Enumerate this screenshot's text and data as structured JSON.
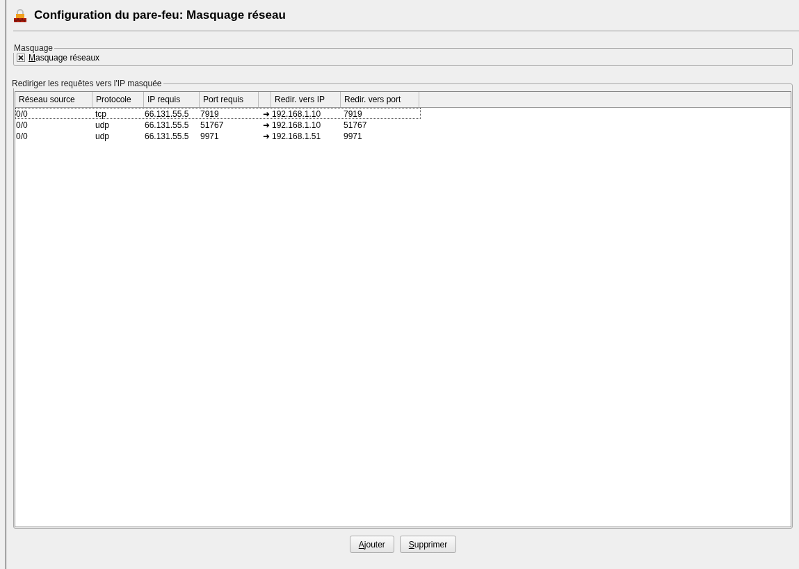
{
  "window": {
    "title": "Configuration du pare-feu: Masquage réseau"
  },
  "masquerade_group": {
    "title": "Masquage",
    "checkbox": {
      "label": "Masquage réseaux",
      "checked": true
    }
  },
  "redirect_group": {
    "title": "Rediriger les requêtes vers l'IP masquée",
    "table": {
      "columns": [
        {
          "kind": "text",
          "label": "Réseau source"
        },
        {
          "kind": "text",
          "label": "Protocole"
        },
        {
          "kind": "text",
          "label": "IP requis"
        },
        {
          "kind": "text",
          "label": "Port requis"
        },
        {
          "kind": "arrow"
        },
        {
          "kind": "text",
          "label": "Redir. vers IP"
        },
        {
          "kind": "text",
          "label": "Redir. vers port"
        }
      ],
      "rows": [
        {
          "cells": [
            "0/0",
            "tcp",
            "66.131.55.5",
            "7919",
            "➜",
            "192.168.1.10",
            "7919"
          ],
          "focused": true
        },
        {
          "cells": [
            "0/0",
            "udp",
            "66.131.55.5",
            "51767",
            "➜",
            "192.168.1.10",
            "51767"
          ],
          "focused": false
        },
        {
          "cells": [
            "0/0",
            "udp",
            "66.131.55.5",
            "9971",
            "➜",
            "192.168.1.51",
            "9971"
          ],
          "focused": false
        }
      ]
    }
  },
  "buttons": [
    "Ajouter",
    "Supprimer"
  ]
}
